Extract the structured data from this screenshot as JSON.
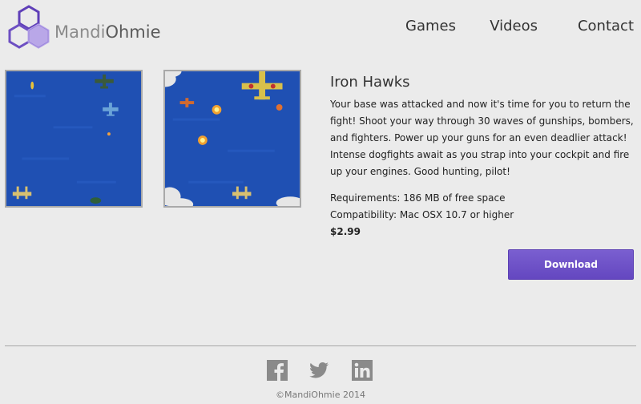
{
  "brand": {
    "name_light": "Mandi",
    "name_dark": "Ohmie",
    "logo_icon": "hexagon-cluster-icon",
    "logo_color": "#7e5fc9"
  },
  "nav": {
    "items": [
      {
        "label": "Games"
      },
      {
        "label": "Videos"
      },
      {
        "label": "Contact"
      }
    ]
  },
  "screenshots": [
    {
      "icon": "game-screenshot-1"
    },
    {
      "icon": "game-screenshot-2"
    }
  ],
  "product": {
    "title": "Iron Hawks",
    "description": "Your base was attacked and now it's time for you to return the fight! Shoot your way through 30 waves of gunships, bombers, and fighters. Power up your guns for an even deadlier attack! Intense dogfights await as you strap into your cockpit and fire up your engines. Good hunting, pilot!",
    "requirements": "Requirements: 186 MB of free space",
    "compatibility": "Compatibility: Mac OSX 10.7 or higher",
    "price": "$2.99",
    "download_label": "Download"
  },
  "footer": {
    "socials": [
      {
        "icon": "facebook-icon"
      },
      {
        "icon": "twitter-icon"
      },
      {
        "icon": "linkedin-icon"
      }
    ],
    "copyright": "©MandiOhmie 2014"
  },
  "colors": {
    "accent": "#6a4dc4",
    "background": "#ebebeb"
  }
}
